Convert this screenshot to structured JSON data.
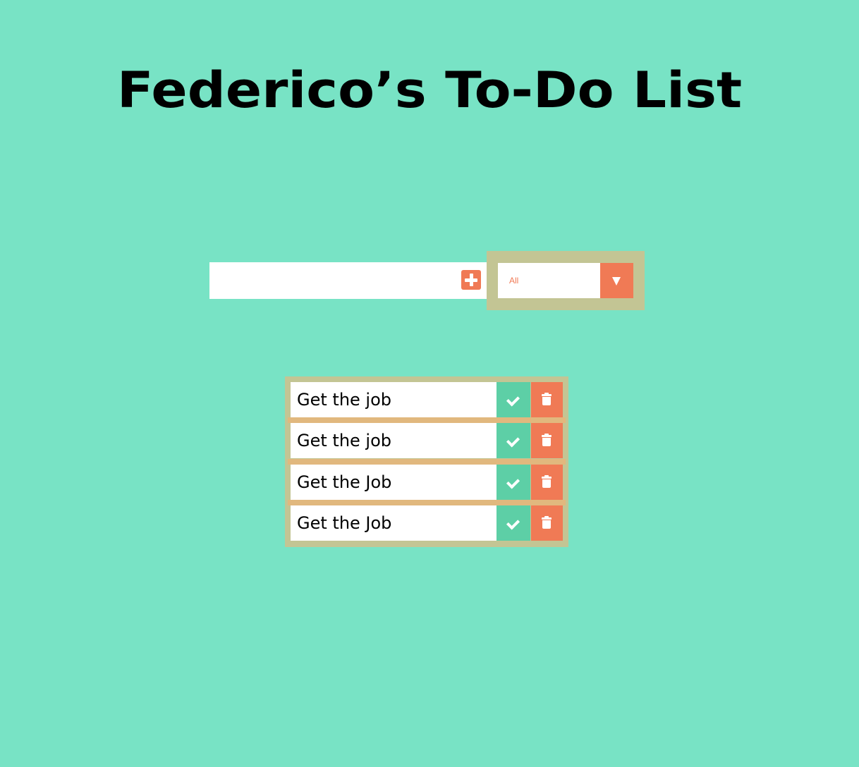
{
  "header": {
    "title": "Federico’s To-Do List"
  },
  "form": {
    "input_value": "",
    "add_icon": "plus-icon",
    "filter": {
      "selected": "All",
      "arrow_icon": "dropdown-arrow-icon"
    }
  },
  "todos": [
    {
      "text": "Get the job",
      "done_icon": "check-icon",
      "delete_icon": "trash-icon"
    },
    {
      "text": "Get the job",
      "done_icon": "check-icon",
      "delete_icon": "trash-icon"
    },
    {
      "text": "Get the Job",
      "done_icon": "check-icon",
      "delete_icon": "trash-icon"
    },
    {
      "text": "Get the Job",
      "done_icon": "check-icon",
      "delete_icon": "trash-icon"
    }
  ],
  "colors": {
    "background": "#78e3c5",
    "accent": "#f07a55",
    "complete": "#5dcfa6",
    "frame": "#c3c594",
    "separator": "#e1b87e"
  }
}
